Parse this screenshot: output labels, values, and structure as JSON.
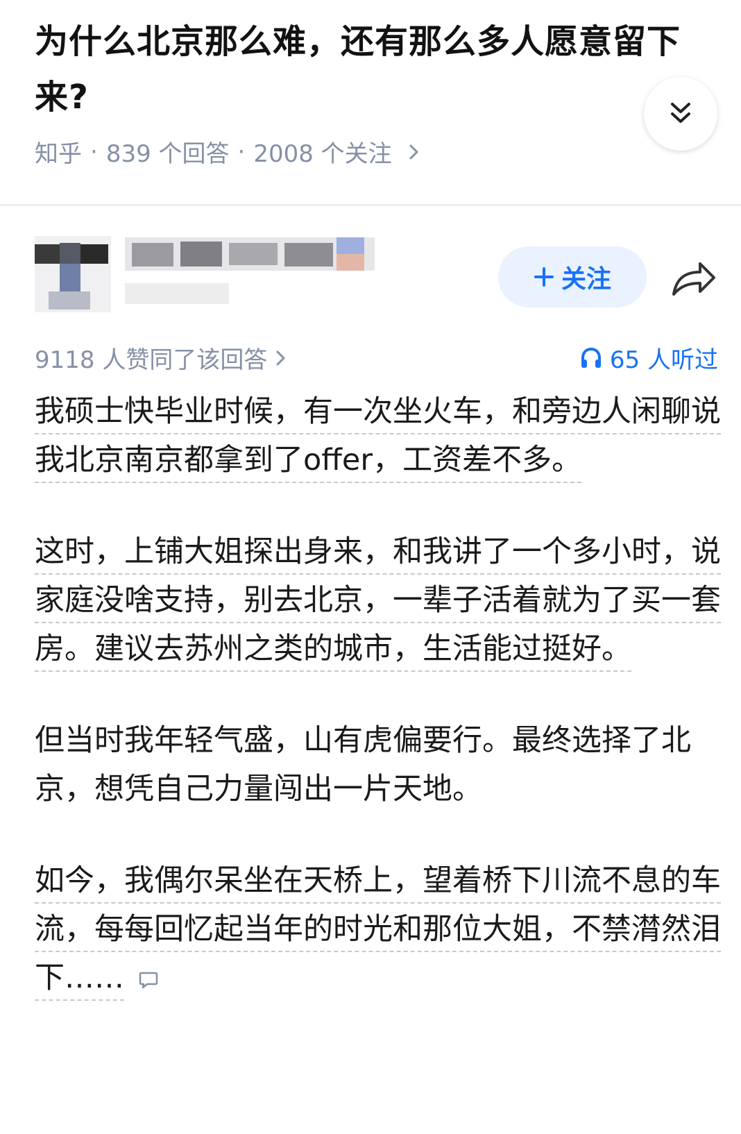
{
  "question": {
    "title": "为什么北京那么难，还有那么多人愿意留下来?",
    "source": "知乎",
    "answers": "839 个回答",
    "followers": "2008 个关注",
    "separator": "·"
  },
  "author": {
    "follow_label": "关注"
  },
  "stats": {
    "likes": "9118 人赞同了该回答",
    "listeners": "65 人听过"
  },
  "content": {
    "paragraphs": [
      "我硕士快毕业时候，有一次坐火车，和旁边人闲聊说我北京南京都拿到了offer，工资差不多。",
      "这时，上铺大姐探出身来，和我讲了一个多小时，说家庭没啥支持，别去北京，一辈子活着就为了买一套房。建议去苏州之类的城市，生活能过挺好。",
      "但当时我年轻气盛，山有虎偏要行。最终选择了北京，想凭自己力量闯出一片天地。",
      "如今，我偶尔呆坐在天桥上，望着桥下川流不息的车流，每每回忆起当年的时光和那位大姐，不禁潸然泪下……"
    ]
  },
  "colors": {
    "accent": "#1772f6",
    "meta": "#8590a6",
    "follow_bg": "#eaf2ff"
  },
  "icons": [
    "collapse-icon",
    "chevron-right-icon",
    "plus-icon",
    "share-icon",
    "headphones-icon",
    "comment-icon"
  ]
}
